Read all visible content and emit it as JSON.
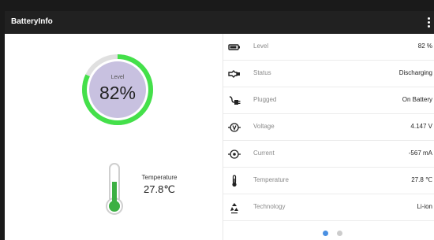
{
  "app": {
    "title": "BatteryInfo",
    "menu_icon": "more-vert-icon"
  },
  "gauge": {
    "label": "Level",
    "value_text": "82%",
    "fraction": 0.82,
    "ring_color": "#44e04a",
    "fill_color": "#c8c1e0"
  },
  "thermometer": {
    "label": "Temperature",
    "value_text": "27.8℃",
    "fill_color": "#3cb043"
  },
  "rows": [
    {
      "icon": "battery-icon",
      "label": "Level",
      "value": "82 %"
    },
    {
      "icon": "plug-status-icon",
      "label": "Status",
      "value": "Discharging"
    },
    {
      "icon": "power-plug-icon",
      "label": "Plugged",
      "value": "On Battery"
    },
    {
      "icon": "voltage-icon",
      "label": "Voltage",
      "value": "4.147 V"
    },
    {
      "icon": "current-icon",
      "label": "Current",
      "value": "-567 mA"
    },
    {
      "icon": "thermometer-icon",
      "label": "Temperature",
      "value": "27.8 ℃"
    },
    {
      "icon": "recycle-icon",
      "label": "Technology",
      "value": "Li-ion"
    }
  ],
  "pager": {
    "active_color": "#4a90e2",
    "inactive_color": "#cccccc",
    "active_index": 0
  }
}
